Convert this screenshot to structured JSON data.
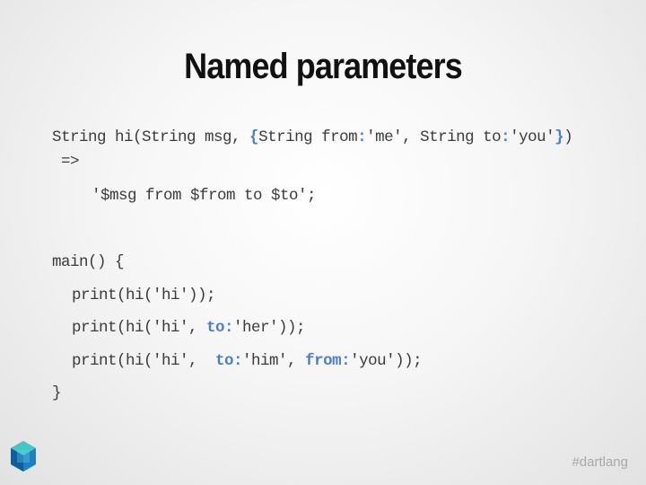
{
  "slide": {
    "title": "Named parameters",
    "hashtag": "#dartlang",
    "accent_color": "#4a7fcf"
  },
  "logo": {
    "icon": "dart-logo-icon"
  },
  "code": {
    "line1": {
      "a": "String hi(String msg, ",
      "b": "{",
      "c": "String from",
      "d": ":",
      "e": "'me', String to",
      "f": ":",
      "g": "'you'",
      "h": "}",
      "i": ")"
    },
    "line2": " =>",
    "line3": "'$msg from $from to $to';",
    "line4": "main() {",
    "line5": "print(hi('hi'));",
    "line6": {
      "a": "print(hi('hi', ",
      "b": "to:",
      "c": "'her'));"
    },
    "line7": {
      "a": "print(hi('hi',  ",
      "b": "to:",
      "c": "'him', ",
      "d": "from:",
      "e": "'you'));"
    },
    "line8": "}"
  }
}
